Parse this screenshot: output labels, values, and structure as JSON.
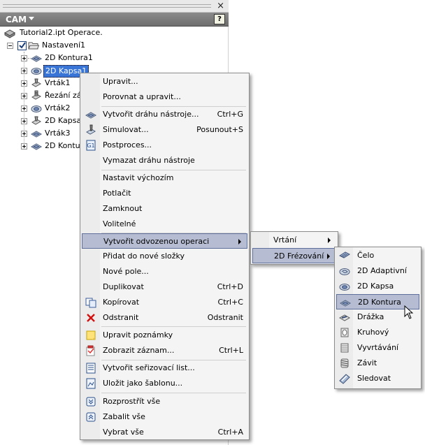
{
  "panel": {
    "title": "CAM",
    "close_glyph": "×",
    "help_glyph": "?"
  },
  "tree": {
    "root": "Tutorial2.ipt Operace.",
    "setup": "Nastavení1",
    "operations": [
      {
        "label": "2D Kontura1",
        "icon": "contour-icon"
      },
      {
        "label": "2D Kapsa1",
        "icon": "pocket-icon",
        "selected": true
      },
      {
        "label": "Vrták1",
        "icon": "drill-icon"
      },
      {
        "label": "Řezání zá",
        "icon": "thread-icon"
      },
      {
        "label": "Vrták2",
        "icon": "pocket-icon"
      },
      {
        "label": "2D Kapsa",
        "icon": "drill-icon"
      },
      {
        "label": "Vrták3",
        "icon": "contour-icon"
      },
      {
        "label": "2D Kontu",
        "icon": "contour-icon"
      }
    ]
  },
  "context_menu": {
    "items": [
      {
        "label": "Upravit...",
        "shortcut": ""
      },
      {
        "label": "Porovnat a upravit...",
        "shortcut": ""
      },
      {
        "label": "Vytvořit dráhu nástroje...",
        "shortcut": "Ctrl+G",
        "icon": "toolpath-icon"
      },
      {
        "label": "Simulovat...",
        "shortcut": "Posunout+S",
        "icon": "simulate-icon"
      },
      {
        "label": "Postproces...",
        "shortcut": "",
        "icon": "post-process-icon"
      },
      {
        "label": "Vymazat dráhu nástroje",
        "shortcut": ""
      },
      {
        "label": "Nastavit výchozím",
        "shortcut": ""
      },
      {
        "label": "Potlačit",
        "shortcut": ""
      },
      {
        "label": "Zamknout",
        "shortcut": ""
      },
      {
        "label": "Volitelné",
        "shortcut": ""
      },
      {
        "label": "Vytvořit odvozenou operaci",
        "shortcut": ""
      },
      {
        "label": "Přidat do nové složky",
        "shortcut": ""
      },
      {
        "label": "Nové pole...",
        "shortcut": ""
      },
      {
        "label": "Duplikovat",
        "shortcut": "Ctrl+D"
      },
      {
        "label": "Kopírovat",
        "shortcut": "Ctrl+C",
        "icon": "copy-icon"
      },
      {
        "label": "Odstranit",
        "shortcut": "Odstranit",
        "icon": "delete-icon"
      },
      {
        "label": "Upravit poznámky",
        "shortcut": "",
        "icon": "notes-icon"
      },
      {
        "label": "Zobrazit záznam...",
        "shortcut": "Ctrl+L",
        "icon": "log-icon"
      },
      {
        "label": "Vytvořit seřizovací list...",
        "shortcut": "",
        "icon": "setup-sheet-icon"
      },
      {
        "label": "Uložit jako šablonu...",
        "shortcut": "",
        "icon": "template-icon"
      },
      {
        "label": "Rozprostřít vše",
        "shortcut": "",
        "icon": "expand-all-icon"
      },
      {
        "label": "Zabalit vše",
        "shortcut": "",
        "icon": "collapse-all-icon"
      },
      {
        "label": "Vybrat vše",
        "shortcut": "Ctrl+A"
      }
    ]
  },
  "submenu_derived": {
    "items": [
      {
        "label": "Vrtání"
      },
      {
        "label": "2D Frézování"
      }
    ]
  },
  "submenu_milling": {
    "items": [
      {
        "label": "Čelo",
        "icon": "face-icon"
      },
      {
        "label": "2D Adaptivní",
        "icon": "adaptive-icon"
      },
      {
        "label": "2D Kapsa",
        "icon": "pocket-icon"
      },
      {
        "label": "2D Kontura",
        "icon": "contour-icon"
      },
      {
        "label": "Drážka",
        "icon": "slot-icon"
      },
      {
        "label": "Kruhový",
        "icon": "circular-icon"
      },
      {
        "label": "Vyvrtávání",
        "icon": "bore-icon"
      },
      {
        "label": "Závit",
        "icon": "thread-icon"
      },
      {
        "label": "Sledovat",
        "icon": "trace-icon"
      }
    ]
  },
  "colors": {
    "selection": "#3875d7",
    "menu_highlight": "#b6bdd2",
    "menu_highlight_border": "#5f6f9c"
  }
}
